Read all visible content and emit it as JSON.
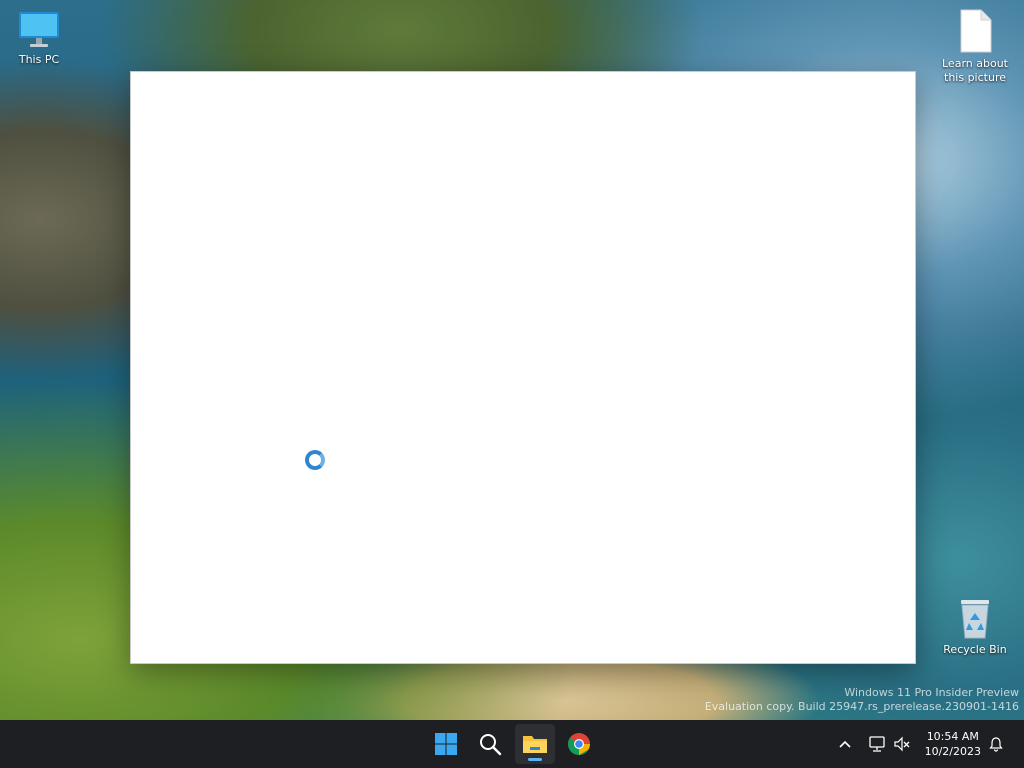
{
  "desktop": {
    "icons": [
      {
        "label": "This PC",
        "icon": "monitor-icon"
      },
      {
        "label": "Learn about this picture",
        "icon": "document-icon"
      },
      {
        "label": "Recycle Bin",
        "icon": "recycle-bin-icon"
      }
    ],
    "watermark": {
      "line1": "Windows 11 Pro Insider Preview",
      "line2": "Evaluation copy. Build 25947.rs_prerelease.230901-1416"
    }
  },
  "window": {
    "state": "loading",
    "spinner_icon": "loading-spinner-icon"
  },
  "taskbar": {
    "apps": [
      {
        "name": "Start",
        "icon": "windows-start-icon"
      },
      {
        "name": "Search",
        "icon": "search-icon"
      },
      {
        "name": "File Explorer",
        "icon": "folder-icon",
        "active": true
      },
      {
        "name": "Google Chrome",
        "icon": "chrome-icon"
      }
    ],
    "tray": {
      "icons": [
        "chevron-up-icon",
        "network-icon",
        "volume-muted-icon",
        "notification-bell-icon"
      ],
      "time": "10:54 AM",
      "date": "10/2/2023"
    }
  },
  "colors": {
    "taskbar_bg": "#1e1f22",
    "accent": "#2f86d0",
    "start_blue": "#3ba7f0",
    "folder_yellow": "#f6c23a"
  }
}
